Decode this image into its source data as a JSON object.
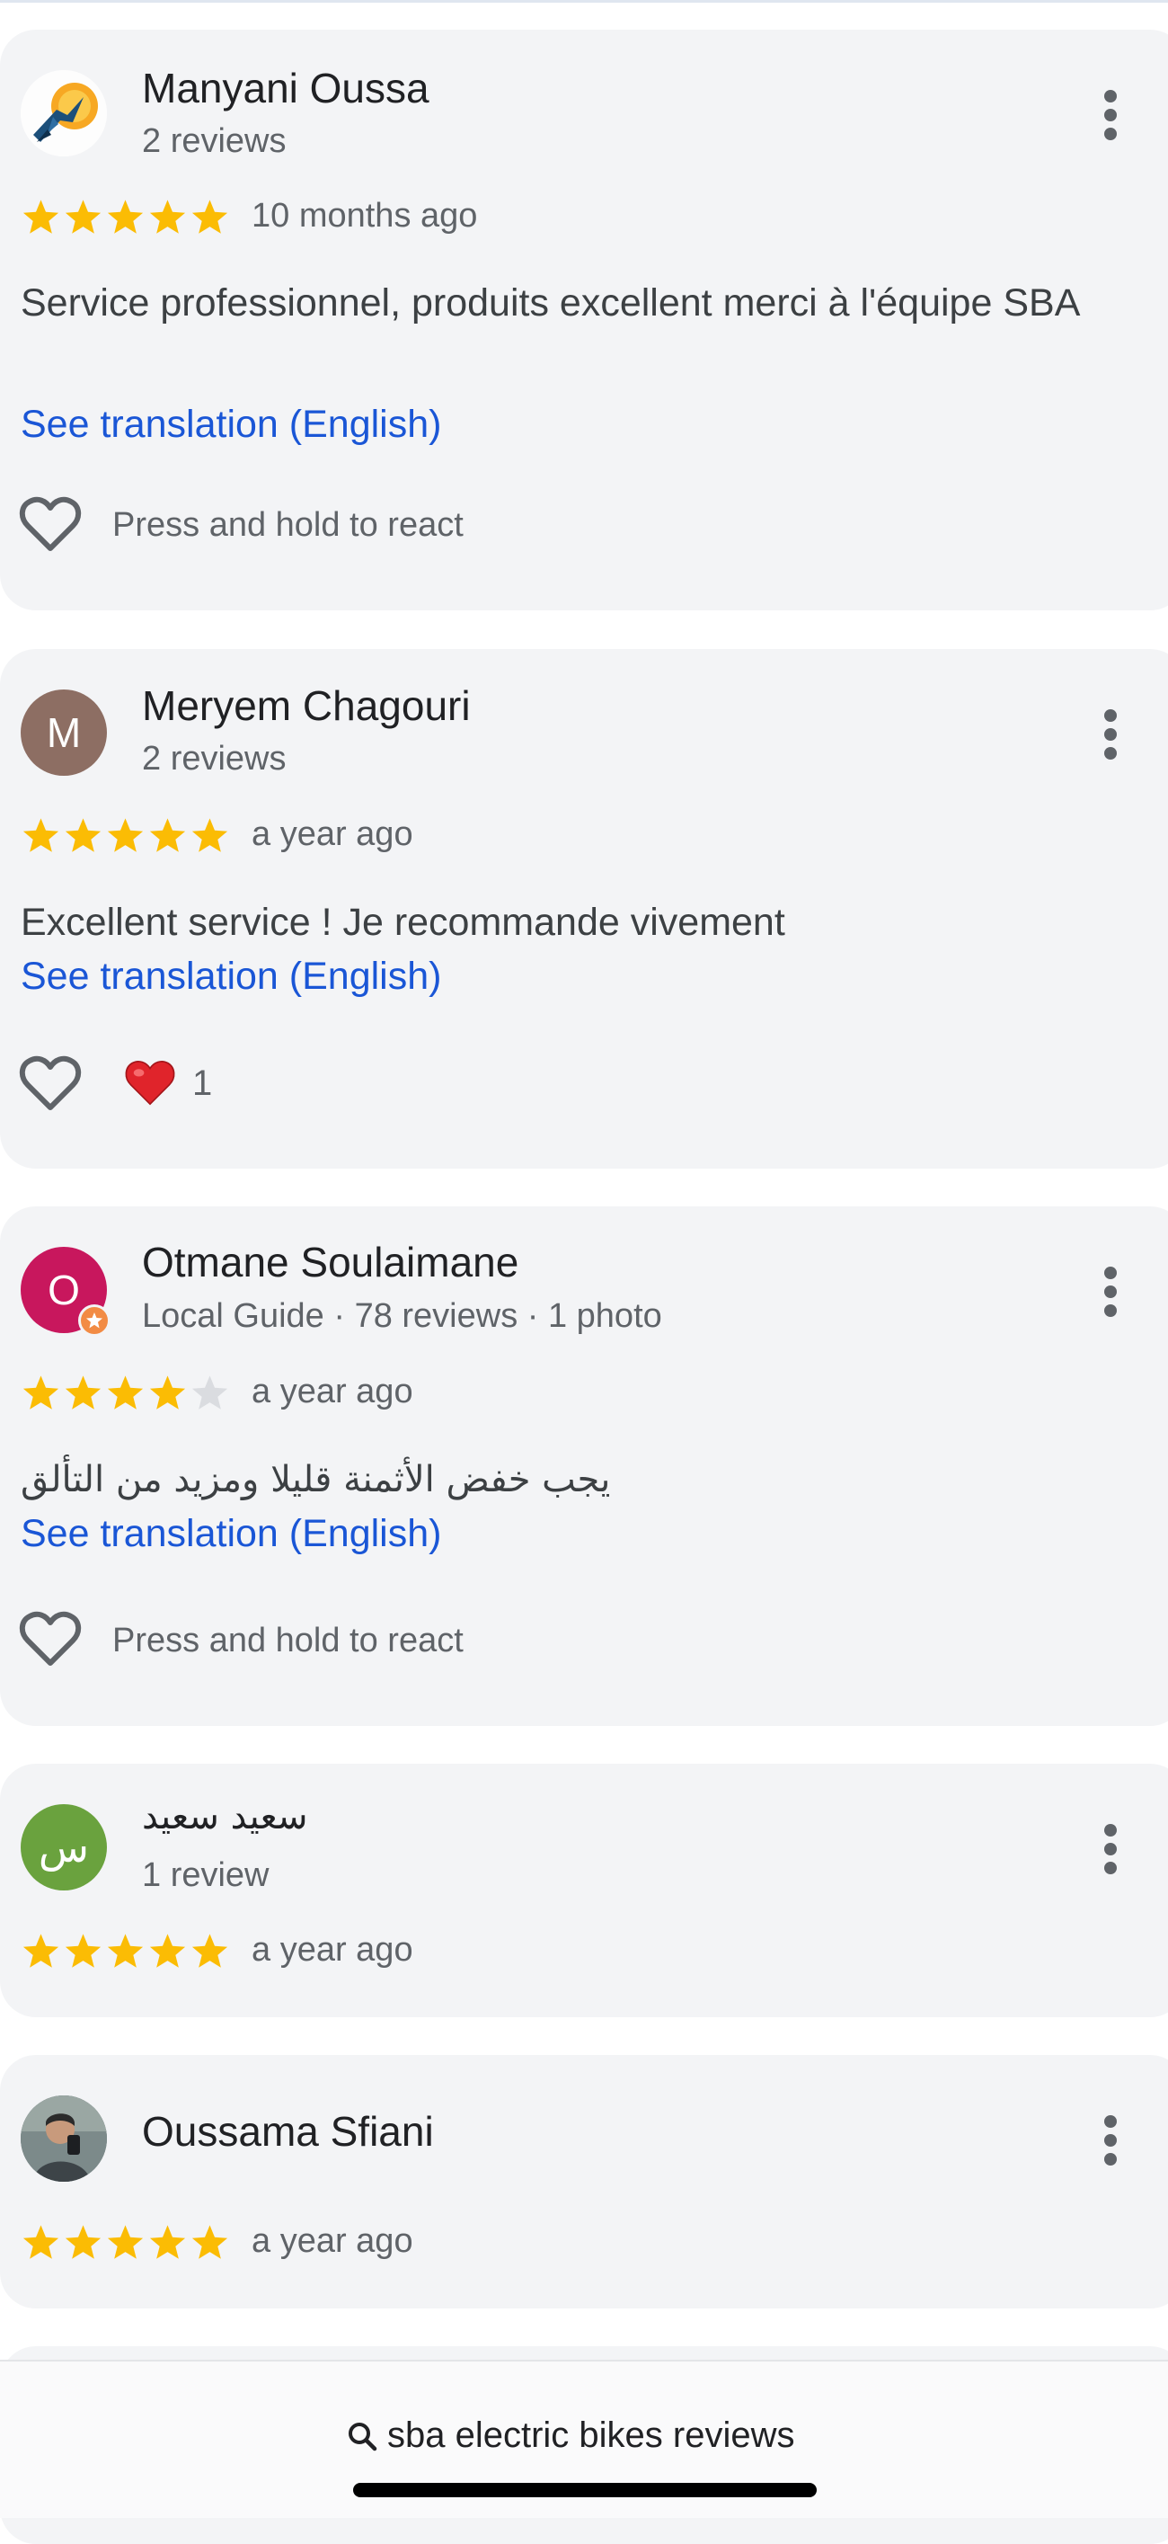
{
  "colors": {
    "card_bg": "#f3f4f6",
    "star_filled": "#fbbc04",
    "star_empty": "#dadce0",
    "link": "#1a56d6",
    "avatar_meryem": "#8d6e63",
    "avatar_otmane": "#c8175d",
    "avatar_said": "#6aa23e"
  },
  "reviews": [
    {
      "name": "Manyani Oussa",
      "meta": "2 reviews",
      "rating": 5,
      "time": "10 months ago",
      "text": "Service professionnel, produits excellent merci à l'équipe SBA",
      "translate": "See translation (English)",
      "react_text": "Press and hold to react",
      "avatar_icon": "bird-logo-avatar"
    },
    {
      "name": "Meryem Chagouri",
      "meta": "2 reviews",
      "rating": 5,
      "time": "a year ago",
      "text": "Excellent service ! Je recommande vivement",
      "translate": "See translation (English)",
      "avatar_letter": "M",
      "reaction_count": "1"
    },
    {
      "name": "Otmane Soulaimane",
      "meta": "Local Guide · 78 reviews · 1 photo",
      "rating": 4,
      "time": "a year ago",
      "text": "يجب خفض الأثمنة قليلا ومزيد من التألق",
      "translate": "See translation (English)",
      "react_text": "Press and hold to react",
      "avatar_letter": "O"
    },
    {
      "name": "سعيد سعيد",
      "meta": "1 review",
      "rating": 5,
      "time": "a year ago",
      "avatar_letter": "س"
    },
    {
      "name": "Oussama Sfiani",
      "rating": 5,
      "time": "a year ago",
      "avatar_icon": "photo-avatar"
    }
  ],
  "bottom": {
    "search_text": "sba electric bikes reviews"
  }
}
